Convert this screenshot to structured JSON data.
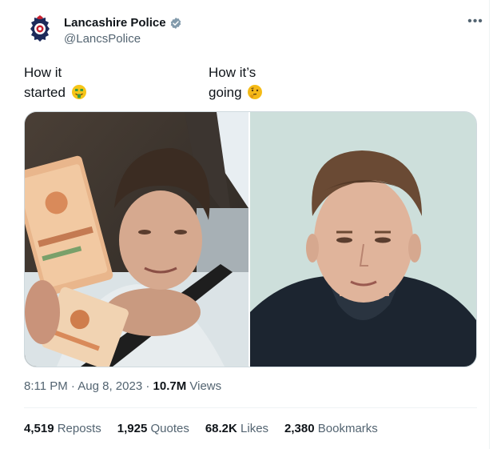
{
  "account": {
    "display_name": "Lancashire Police",
    "handle": "@LancsPolice"
  },
  "tweet": {
    "caption_left_line1": "How it",
    "caption_left_line2": "started",
    "caption_right_line1": "How it’s",
    "caption_right_line2": "going"
  },
  "meta": {
    "time": "8:11 PM",
    "sep1": " · ",
    "date": "Aug 8, 2023",
    "sep2": " · ",
    "views_count": "10.7M",
    "views_label": " Views"
  },
  "stats": {
    "reposts_count": "4,519",
    "reposts_label": " Reposts",
    "quotes_count": "1,925",
    "quotes_label": " Quotes",
    "likes_count": "68.2K",
    "likes_label": " Likes",
    "bookmarks_count": "2,380",
    "bookmarks_label": " Bookmarks"
  },
  "colors": {
    "verified": "#829aab",
    "text_secondary": "#536471",
    "text_primary": "#0f1419"
  }
}
